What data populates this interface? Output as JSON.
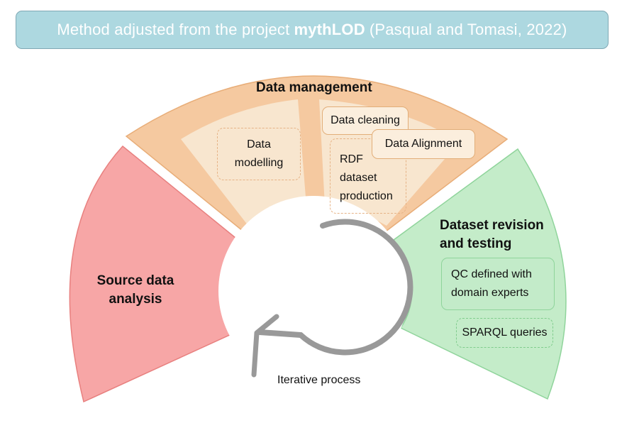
{
  "title": {
    "prefix": "Method adjusted from the project",
    "project": "mythLOD",
    "suffix": "(Pasqual and Tomasi, 2022)"
  },
  "sections": {
    "data_management": {
      "heading": "Data management",
      "modelling": [
        "Data",
        "modelling"
      ],
      "rdf": [
        "RDF",
        "dataset",
        "production"
      ],
      "cleaning": "Data cleaning",
      "alignment": "Data Alignment"
    },
    "source_analysis": {
      "heading": [
        "Source data",
        "analysis"
      ]
    },
    "revision": {
      "heading": [
        "Dataset revision",
        "and testing"
      ],
      "qc": [
        "QC defined with",
        "domain experts"
      ],
      "sparql": "SPARQL queries"
    }
  },
  "cycle_label": "Iterative process",
  "colors": {
    "red": "#f7a6a6",
    "orange": "#f5c9a0",
    "cream": "#f8e6cf",
    "green": "#c4ecc9",
    "title_bg": "#add8e0",
    "arrow": "#999999"
  },
  "icons": {
    "cycle": "circular-arrow-icon"
  }
}
